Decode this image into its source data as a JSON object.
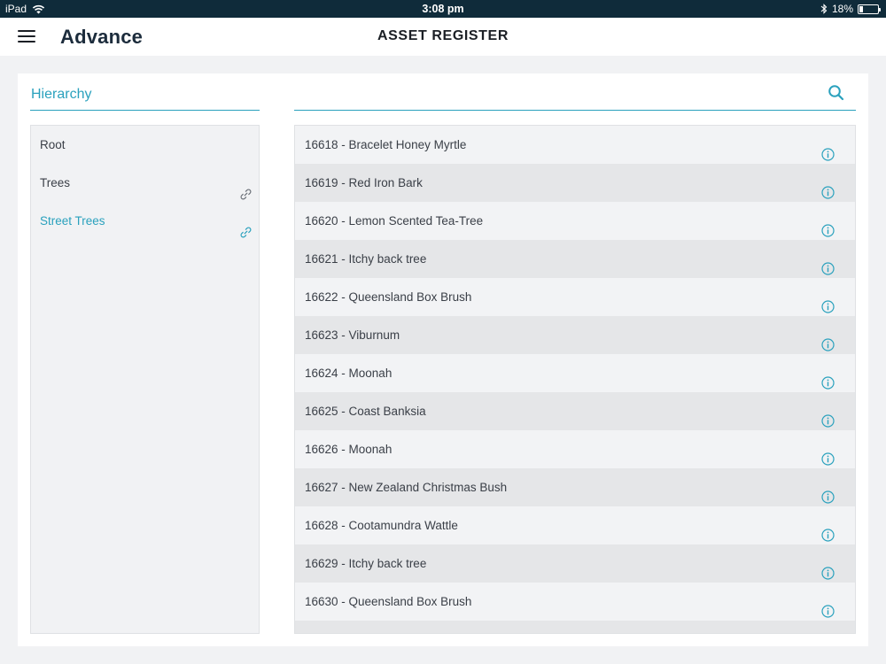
{
  "status_bar": {
    "device": "iPad",
    "time": "3:08 pm",
    "battery": "18%",
    "battery_level": 0.18
  },
  "header": {
    "logo": "Advance",
    "title": "ASSET REGISTER"
  },
  "hierarchy": {
    "title": "Hierarchy",
    "items": [
      {
        "label": "Root",
        "has_link": false,
        "active": false
      },
      {
        "label": "Trees",
        "has_link": true,
        "active": false
      },
      {
        "label": "Street Trees",
        "has_link": true,
        "active": true
      }
    ]
  },
  "assets": [
    "16618 - Bracelet Honey Myrtle",
    "16619 - Red Iron Bark",
    "16620 - Lemon Scented Tea-Tree",
    "16621 - Itchy back tree",
    "16622 - Queensland Box Brush",
    "16623 - Viburnum",
    "16624 - Moonah",
    "16625 - Coast Banksia",
    "16626 - Moonah",
    "16627 - New Zealand Christmas Bush",
    "16628 - Cootamundra Wattle",
    "16629 - Itchy back tree",
    "16630 - Queensland Box Brush",
    ""
  ],
  "colors": {
    "accent": "#2aa1bd",
    "status_bar": "#0f2b3a"
  }
}
